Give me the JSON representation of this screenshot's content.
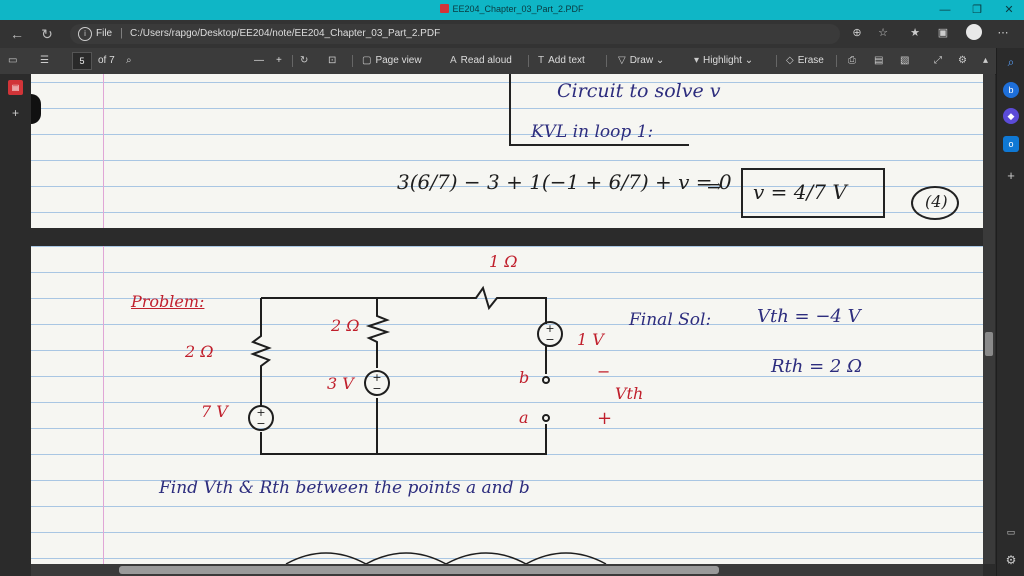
{
  "window": {
    "title": "EE204_Chapter_03_Part_2.PDF",
    "minimize": "—",
    "restore": "❐",
    "close": "✕"
  },
  "addressbar": {
    "back": "←",
    "refresh": "↻",
    "file_label": "File",
    "separator": "|",
    "path": "C:/Users/rapgo/Desktop/EE204/note/EE204_Chapter_03_Part_2.PDF",
    "icons": [
      "zoom-icon",
      "favorite-add-icon",
      "favorites-icon",
      "collections-icon",
      "profile-avatar",
      "more-icon"
    ]
  },
  "toolbar": {
    "page_current": "5",
    "page_total": "of 7",
    "zoom_out": "—",
    "zoom_in": "+",
    "page_view": "Page view",
    "read_aloud": "Read aloud",
    "add_text": "Add text",
    "draw": "Draw",
    "highlight": "Highlight",
    "erase": "Erase"
  },
  "page1": {
    "line1": "Circuit to solve v",
    "line2": "KVL in loop 1:",
    "equation": "3(6/7) − 3 + 1(−1 + 6/7) + v = 0",
    "implies": "⇒",
    "answer": "v = 4/7 V",
    "step": "(4)"
  },
  "page2": {
    "problem_label": "Problem:",
    "r_top": "1 Ω",
    "r_left": "2 Ω",
    "r_mid": "2 Ω",
    "v_left": "7 V",
    "v_mid": "3 V",
    "v_right": "1 V",
    "terminal_b": "b",
    "terminal_a": "a",
    "minus": "−",
    "plus": "+",
    "vth_label": "Vth",
    "final_sol_label": "Final Sol:",
    "vth_value": "Vth = −4 V",
    "rth_value": "Rth = 2 Ω",
    "find_text": "Find Vth & Rth between the points a and b"
  }
}
